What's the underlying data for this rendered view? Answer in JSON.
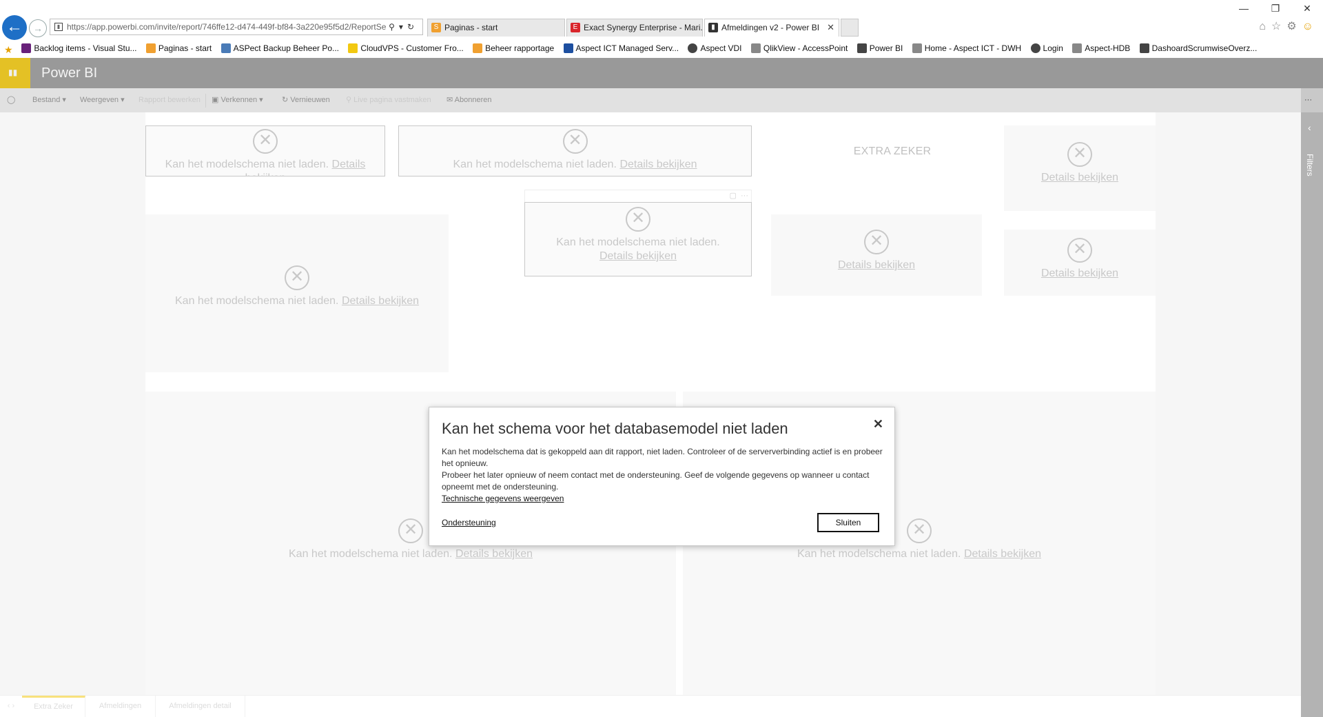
{
  "browser": {
    "address": "https://app.powerbi.com/invite/report/746ffe12-d474-449f-bf84-3a220e95f5d2/ReportSe",
    "tabs": [
      {
        "label": "Paginas - start",
        "icon": "sharepoint-icon",
        "color": "#f0a030"
      },
      {
        "label": "Exact Synergy Enterprise - Mari...",
        "icon": "exact-icon",
        "color": "#d9252a"
      },
      {
        "label": "Afmeldingen v2 - Power BI",
        "icon": "powerbi-icon",
        "color": "#333333"
      }
    ],
    "bookmarks": [
      {
        "label": "Backlog items - Visual Stu...",
        "color": "#68217a"
      },
      {
        "label": "Paginas - start",
        "color": "#f0a030"
      },
      {
        "label": "ASPect Backup Beheer Po...",
        "color": "#4a7bb7"
      },
      {
        "label": "CloudVPS - Customer Fro...",
        "color": "#f2c811"
      },
      {
        "label": "Beheer rapportage",
        "color": "#f0a030"
      },
      {
        "label": "Aspect ICT Managed Serv...",
        "color": "#1d4fa0"
      },
      {
        "label": "Aspect VDI",
        "color": "#444444"
      },
      {
        "label": "QlikView - AccessPoint",
        "color": "#444444"
      },
      {
        "label": "Power BI",
        "color": "#444444"
      },
      {
        "label": "Home - Aspect ICT - DWH",
        "color": "#444444"
      },
      {
        "label": "Login",
        "color": "#444444"
      },
      {
        "label": "Aspect-HDB",
        "color": "#444444"
      },
      {
        "label": "DashoardScrumwiseOverz...",
        "color": "#444444"
      }
    ]
  },
  "app": {
    "title": "Power BI",
    "brand_color": "#f2c811"
  },
  "toolbar": {
    "file": "Bestand",
    "view": "Weergeven",
    "edit_report": "Rapport bewerken",
    "explore": "Verkennen",
    "refresh": "Vernieuwen",
    "pin": "Live pagina vastmaken",
    "subscribe": "Abonneren",
    "more": "···"
  },
  "report": {
    "error_text": "Kan het modelschema niet laden.",
    "details_link": "Details bekijken",
    "extra_title": "EXTRA ZEKER",
    "card_more": "···"
  },
  "filters": {
    "label": "Filters"
  },
  "pages": {
    "tabs": [
      "Extra Zeker",
      "Afmeldingen",
      "Afmeldingen detail"
    ],
    "active": "Extra Zeker"
  },
  "dialog": {
    "title": "Kan het schema voor het databasemodel niet laden",
    "para1": "Kan het modelschema dat is gekoppeld aan dit rapport, niet laden. Controleer of de serververbinding actief is en probeer het opnieuw.",
    "para2": "Probeer het later opnieuw of neem contact met de ondersteuning. Geef de volgende gegevens op wanneer u contact opneemt met de ondersteuning.",
    "tech_link": "Technische gegevens weergeven",
    "support_link": "Ondersteuning",
    "close_button": "Sluiten"
  }
}
